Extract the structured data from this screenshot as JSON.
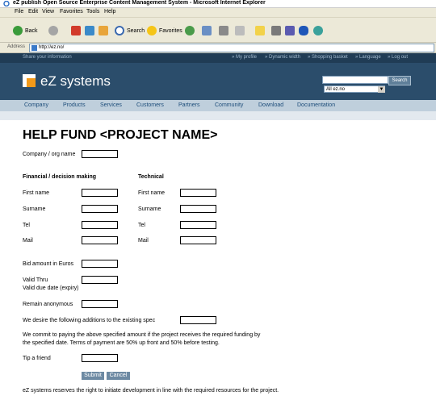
{
  "window": {
    "title": "eZ publish Open Source Enterprise Content Management System - Microsoft Internet Explorer"
  },
  "menu": [
    "File",
    "Edit",
    "View",
    "Favorites",
    "Tools",
    "Help"
  ],
  "toolbar": {
    "back_label": "Back",
    "search_label": "Search",
    "favorites_label": "Favorites"
  },
  "address": {
    "label": "Address",
    "url": "http://ez.no/"
  },
  "site": {
    "top_left": "Share your information",
    "top_links": [
      "My profile",
      "Dynamic width",
      "Shopping basket",
      "Language",
      "Log out"
    ],
    "logo_text": "eZ systems",
    "search_button": "Search",
    "scope_select": "All ez.no",
    "nav": [
      "Company",
      "Products",
      "Services",
      "Customers",
      "Partners",
      "Community",
      "Download",
      "Documentation"
    ]
  },
  "form": {
    "heading": "HELP FUND <PROJECT NAME>",
    "company_label": "Company / org name",
    "financial_heading": "Financial / decision making",
    "technical_heading": "Technical",
    "first_name": "First name",
    "surname": "Surname",
    "tel": "Tel",
    "mail": "Mail",
    "bid_amount": "Bid amount in Euros",
    "valid_thru": "Valid Thru",
    "valid_due": "Valid due date (expiry)",
    "remain_anon": "Remain anonymous",
    "additions": "We desire the following additions to the existing spec",
    "commit_line1": "We commit to paying the above specified amount if the project receives the required funding by",
    "commit_line2": "the specified date. Terms of payment are 50% up front and 50% before testing.",
    "tip_friend": "Tip a friend",
    "submit": "Submit",
    "cancel": "Cancel",
    "footer": "eZ systems reserves the right to initiate development in line with the required resources for the project."
  },
  "colors": {
    "banner": "#2b4d6b",
    "nav_bg": "#bfcfdc",
    "nav_text": "#1d4d7a",
    "button": "#6d8aa3",
    "logo_orange": "#f39a1a"
  }
}
